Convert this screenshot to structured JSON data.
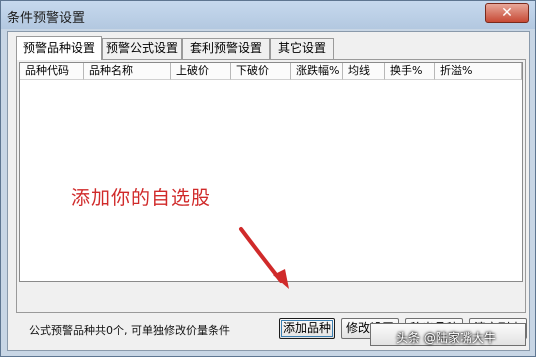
{
  "window": {
    "title": "条件预警设置",
    "close_glyph": "✕"
  },
  "tabs": [
    {
      "label": "预警品种设置",
      "active": true
    },
    {
      "label": "预警公式设置",
      "active": false
    },
    {
      "label": "套利预警设置",
      "active": false
    },
    {
      "label": "其它设置",
      "active": false
    }
  ],
  "table": {
    "columns": [
      "品种代码",
      "品种名称",
      "上破价",
      "下破价",
      "涨跌幅%",
      "均线",
      "换手%",
      "折溢%"
    ],
    "rows": []
  },
  "annotation": {
    "text": "添加你的自选股",
    "color": "#d02a2a"
  },
  "status": {
    "text": "公式预警品种共0个, 可单独修改价量条件"
  },
  "buttons": {
    "add": "添加品种",
    "modify": "修改设置",
    "remove": "移出品种",
    "clear": "清空列表"
  },
  "watermark": {
    "text": "头条 @陆家嘴大牛"
  }
}
